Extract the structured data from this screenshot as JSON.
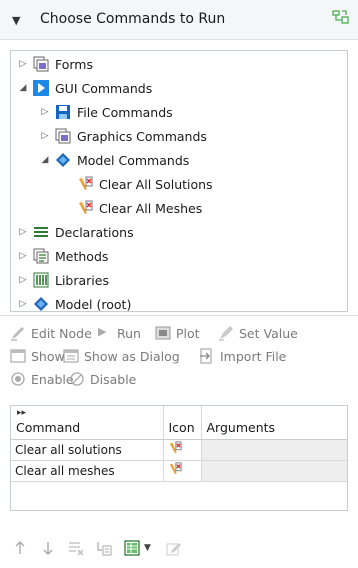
{
  "header": {
    "title": "Choose Commands to Run"
  },
  "tree": [
    {
      "label": "Forms",
      "icon": "forms-icon",
      "expander": "collapsed"
    },
    {
      "label": "GUI Commands",
      "icon": "gui-commands-icon",
      "expander": "expanded"
    },
    {
      "label": "File Commands",
      "icon": "save-icon",
      "expander": "collapsed"
    },
    {
      "label": "Graphics Commands",
      "icon": "forms-icon",
      "expander": "collapsed"
    },
    {
      "label": "Model Commands",
      "icon": "model-icon",
      "expander": "expanded"
    },
    {
      "label": "Clear All Solutions",
      "icon": "clear-icon",
      "expander": "none"
    },
    {
      "label": "Clear All Meshes",
      "icon": "clear-icon",
      "expander": "none"
    },
    {
      "label": "Declarations",
      "icon": "declarations-icon",
      "expander": "collapsed"
    },
    {
      "label": "Methods",
      "icon": "forms-icon",
      "expander": "collapsed"
    },
    {
      "label": "Libraries",
      "icon": "libraries-icon",
      "expander": "collapsed"
    },
    {
      "label": "Model (root)",
      "icon": "model-icon",
      "expander": "collapsed"
    }
  ],
  "toolbar": {
    "edit_node": "Edit Node",
    "run": "Run",
    "plot": "Plot",
    "set_value": "Set Value",
    "show": "Show",
    "show_as_dialog": "Show as Dialog",
    "import_file": "Import File",
    "enable": "Enable",
    "disable": "Disable"
  },
  "table": {
    "columns": [
      "Command",
      "Icon",
      "Arguments"
    ],
    "rows": [
      {
        "command": "Clear all solutions",
        "icon": "clear-icon",
        "arguments": ""
      },
      {
        "command": "Clear all meshes",
        "icon": "clear-icon",
        "arguments": ""
      }
    ]
  },
  "bottom_toolbar": [
    "move-up-icon",
    "move-down-icon",
    "delete-icon",
    "add-row-icon",
    "table-icon",
    "dropdown-arrow-icon",
    "edit-icon"
  ],
  "colors": {
    "accent": "#1e88e5",
    "header_bg": "#f4f6f8",
    "disabled_text": "#7b7b7b"
  }
}
